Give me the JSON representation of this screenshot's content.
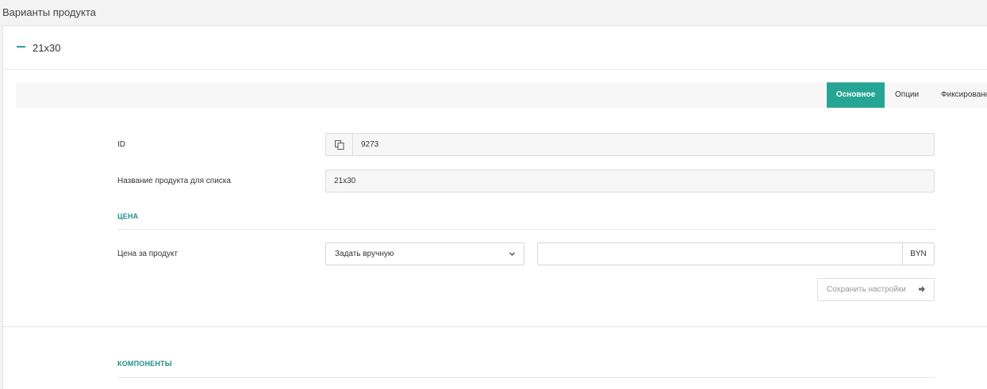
{
  "page": {
    "title": "Варианты продукта"
  },
  "variant": {
    "title": "21x30"
  },
  "tabs": [
    {
      "label": "Основное",
      "active": true
    },
    {
      "label": "Опции",
      "active": false
    },
    {
      "label": "Фиксированные",
      "active": false
    }
  ],
  "form": {
    "id_label": "ID",
    "id_value": "9273",
    "name_label": "Название продукта для списка",
    "name_value": "21x30",
    "price_section": "ЦЕНА",
    "price_label": "Цена за продукт",
    "price_mode": "Задать вручную",
    "price_value": "",
    "currency": "BYN",
    "save_label": "Сохранить настройки"
  },
  "components": {
    "section_title": "КОМПОНЕНТЫ"
  },
  "icons": {
    "collapse": "minus-icon",
    "copy": "copy-icon",
    "dropdown": "chevron-down-icon",
    "save": "arrow-right-icon"
  },
  "colors": {
    "accent": "#26a595",
    "section_title": "#1f8f83"
  }
}
